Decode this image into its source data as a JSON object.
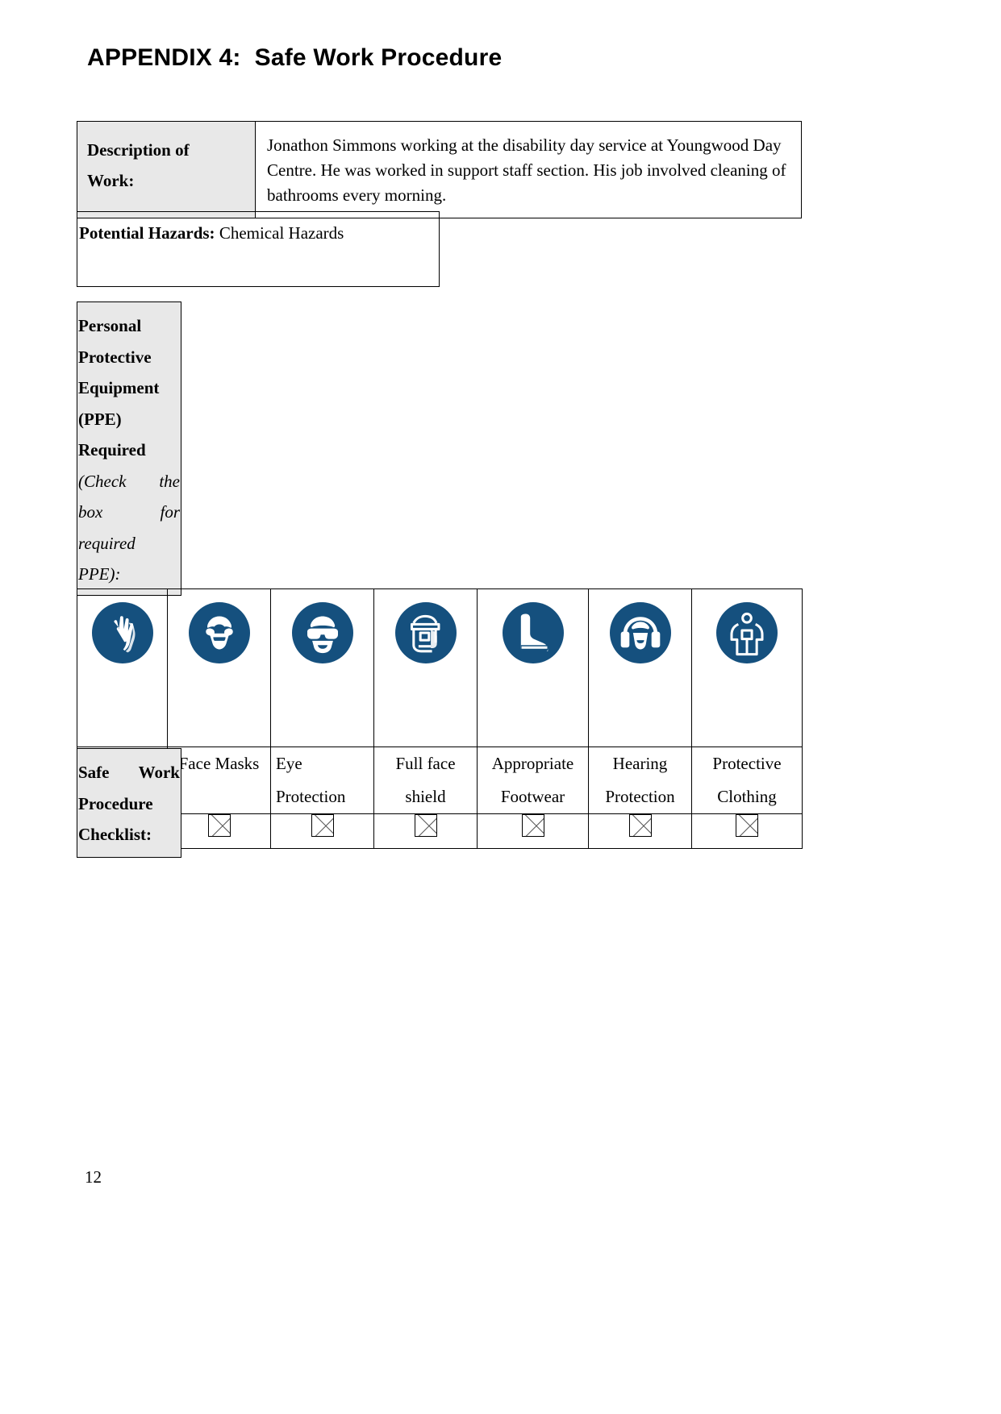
{
  "document": {
    "title": "APPENDIX 4:  Safe Work Procedure",
    "page_number": "12"
  },
  "description_table": {
    "label_line_1": "Description of",
    "label_line_2": "Work:",
    "body": "Jonathon Simmons working at the disability day service at Youngwood Day Centre. He was worked in support staff section. His job involved cleaning of bathrooms every morning."
  },
  "hazards": {
    "label": "Potential Hazards:",
    "value": "Chemical Hazards"
  },
  "ppe_block": {
    "heading_lines": [
      "Personal",
      "Protective",
      "Equipment",
      "(PPE)",
      "Required"
    ],
    "note_lines": [
      "(Check the",
      "box for",
      "required",
      "PPE):"
    ]
  },
  "ppe_items": [
    {
      "label": "Gloves",
      "label_line2": "",
      "icon": "gloves-icon",
      "checked": false,
      "center": true
    },
    {
      "label": "Face Masks",
      "label_line2": "",
      "icon": "face-mask-icon",
      "checked": false,
      "center": true
    },
    {
      "label": "Eye",
      "label_line2": "Protection",
      "icon": "eye-protection-icon",
      "checked": false,
      "center": false
    },
    {
      "label": "Full face",
      "label_line2": "shield",
      "icon": "full-face-shield-icon",
      "checked": false,
      "center": true
    },
    {
      "label": "Appropriate",
      "label_line2": "Footwear",
      "icon": "safety-boot-icon",
      "checked": false,
      "center": true
    },
    {
      "label": "Hearing",
      "label_line2": "Protection",
      "icon": "hearing-protection-icon",
      "checked": false,
      "center": true
    },
    {
      "label": "Protective",
      "label_line2": "Clothing",
      "icon": "protective-clothing-icon",
      "checked": false,
      "center": true
    }
  ],
  "checklist_block": {
    "heading_lines": [
      "Safe Work",
      "Procedure",
      "Checklist:"
    ]
  },
  "colors": {
    "icon_blue": "#15507e",
    "shaded_cell": "#e8e8e8",
    "border": "#000000",
    "text": "#000000"
  }
}
